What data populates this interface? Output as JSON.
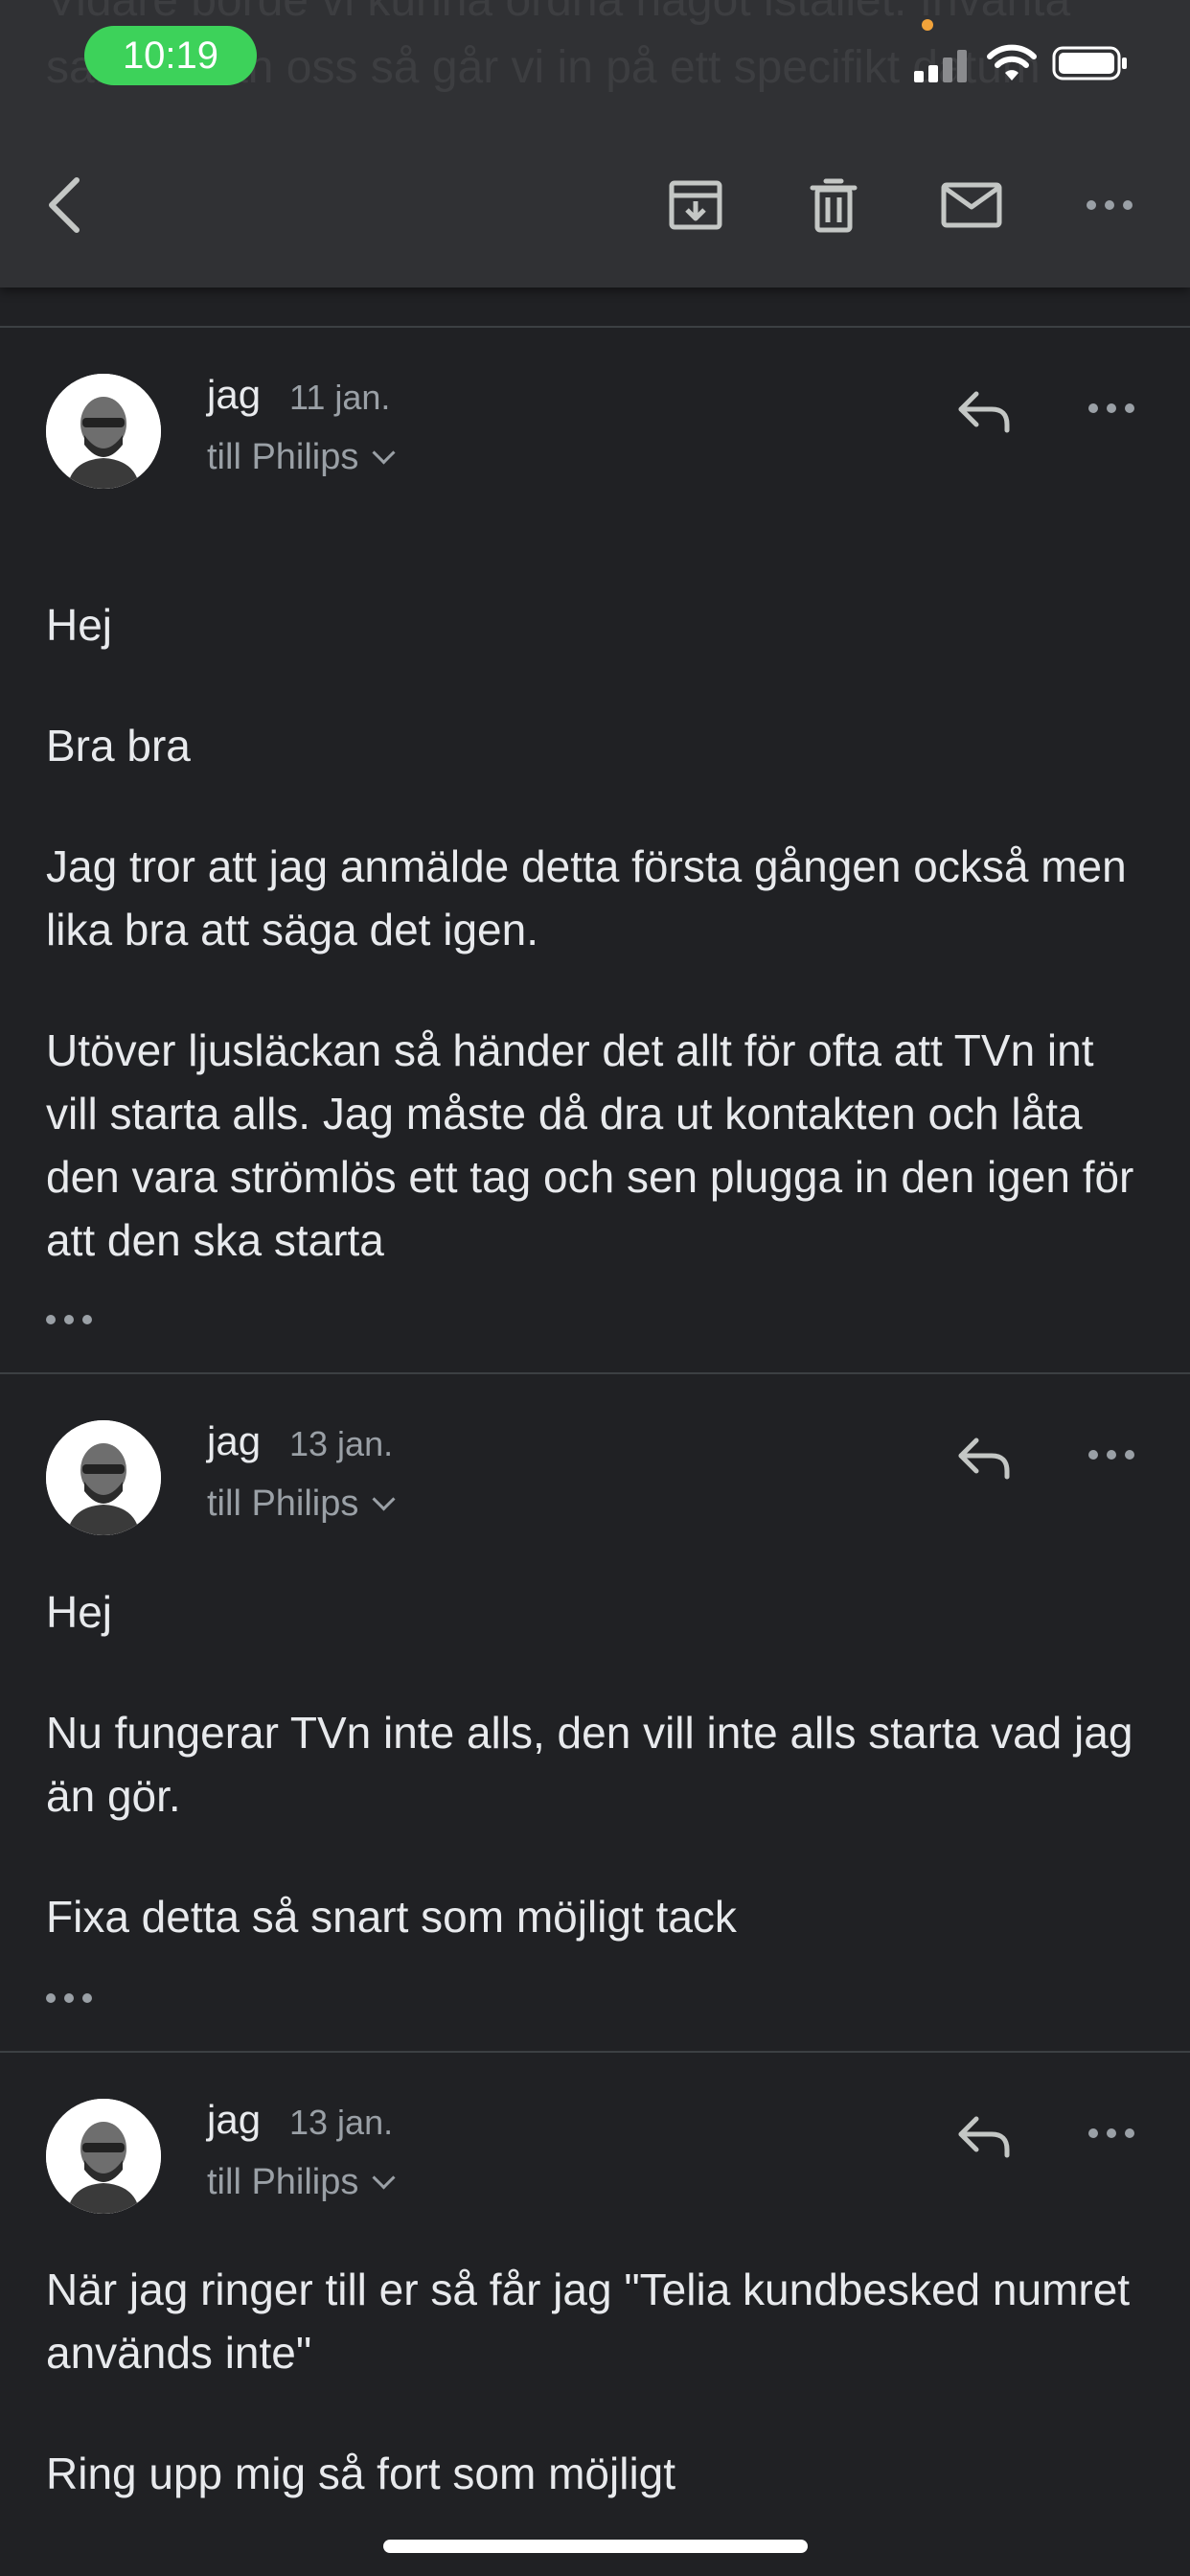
{
  "status_bar": {
    "time": "10:19"
  },
  "header_ghost_text": "Vidare borde vi kunna ordna något istället. Invänta samtal från oss så går vi in på ett specifikt datum",
  "toolbar": {
    "back_icon": "chevron-left-icon",
    "archive_icon": "archive-icon",
    "delete_icon": "trash-icon",
    "mark_unread_icon": "mail-icon",
    "more_icon": "more-horizontal-icon"
  },
  "messages": [
    {
      "sender": "jag",
      "date": "11 jan.",
      "recipient": "till Philips",
      "paragraphs": [
        "Hej",
        "Bra bra",
        "Jag tror att jag anmälde detta första gången också men lika bra att säga det igen.",
        "Utöver ljusläckan så händer det allt för ofta att TVn int vill starta alls. Jag måste då dra ut kontakten och låta den vara strömlös ett tag och sen plugga in den igen för att den ska starta"
      ]
    },
    {
      "sender": "jag",
      "date": "13 jan.",
      "recipient": "till Philips",
      "paragraphs": [
        "Hej",
        "Nu fungerar TVn inte alls, den vill inte alls starta vad jag än gör.",
        "Fixa detta så snart som möjligt tack"
      ]
    },
    {
      "sender": "jag",
      "date": "13 jan.",
      "recipient": "till Philips",
      "paragraphs": [
        "När jag ringer till er så får jag \"Telia kundbesked numret används inte\"",
        "Ring upp mig så fort som möjligt"
      ]
    }
  ],
  "colors": {
    "background": "#202124",
    "toolbar": "#303134",
    "status_time_pill": "#3dd25a",
    "secondary_text": "#9aa0a6"
  }
}
